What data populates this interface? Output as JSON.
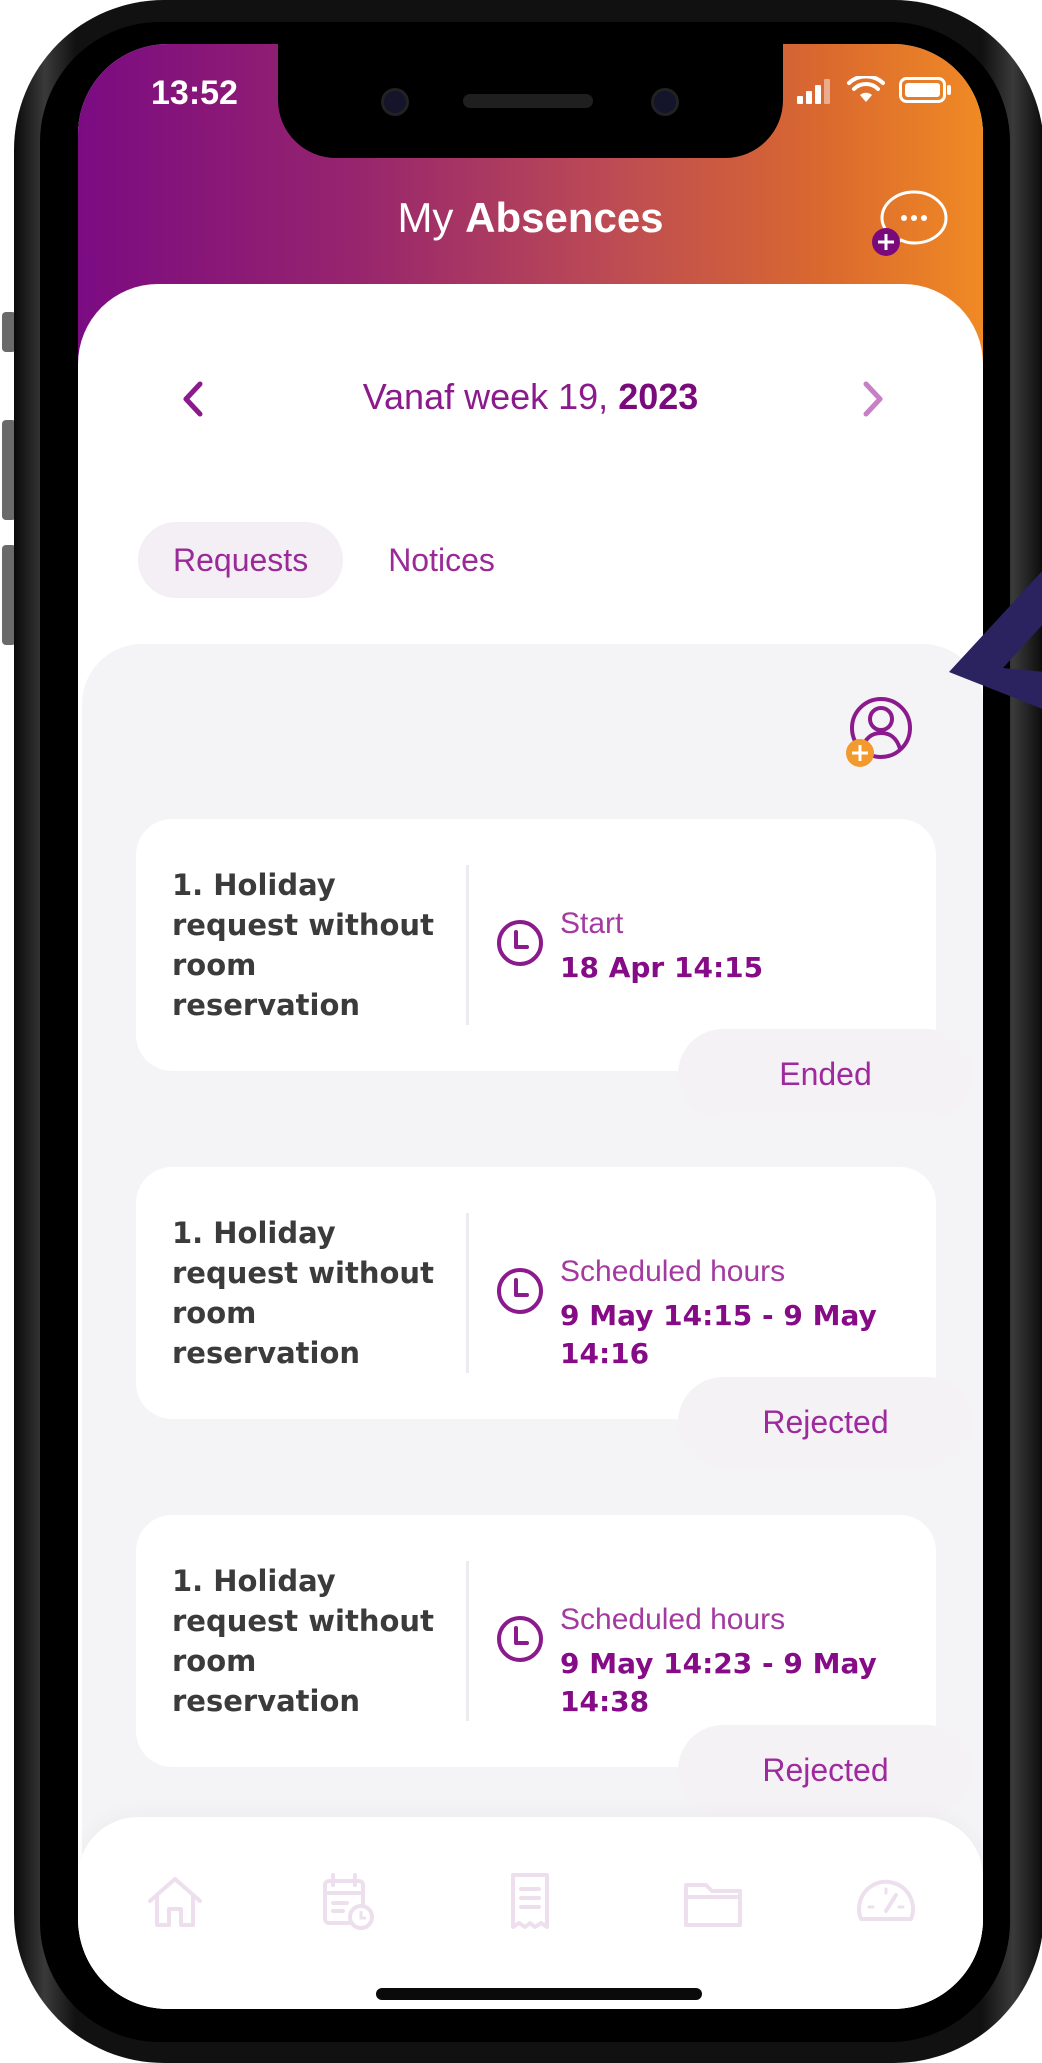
{
  "status_bar": {
    "time": "13:52"
  },
  "header": {
    "title_light": "My",
    "title_bold": "Absences",
    "chat_icon": "chat-add-icon"
  },
  "week_nav": {
    "label_prefix": "Vanaf week 19,",
    "year": "2023"
  },
  "tabs": [
    {
      "label": "Requests",
      "active": true
    },
    {
      "label": "Notices",
      "active": false
    }
  ],
  "cards": [
    {
      "title": "1. Holiday request without room reservation",
      "detail_label": "Start",
      "detail_value": "18 Apr 14:15",
      "status": "Ended"
    },
    {
      "title": "1. Holiday request without room reservation",
      "detail_label": "Scheduled hours",
      "detail_value": "9 May 14:15 - 9 May 14:16",
      "status": "Rejected"
    },
    {
      "title": "1. Holiday request without room reservation",
      "detail_label": "Scheduled hours",
      "detail_value": "9 May 14:23 - 9 May 14:38",
      "status": "Rejected"
    }
  ],
  "tab_bar": {
    "items": [
      "home-icon",
      "calendar-clock-icon",
      "receipt-icon",
      "folder-icon",
      "speedometer-icon"
    ],
    "color": "#eddfee"
  },
  "colors": {
    "accent": "#860b86",
    "gradient_start": "#7b0b82",
    "gradient_end": "#f08a24",
    "badge_orange": "#f29a2e",
    "arrow": "#2a2360"
  }
}
